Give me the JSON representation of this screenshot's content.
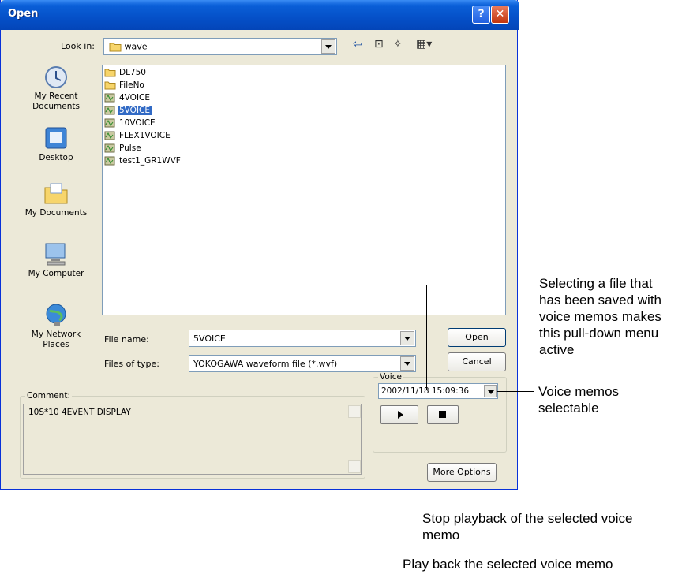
{
  "window": {
    "title": "Open"
  },
  "toolbar": {
    "look_in_label": "Look in:",
    "look_in_value": "wave"
  },
  "places": [
    {
      "label": "My Recent\nDocuments"
    },
    {
      "label": "Desktop"
    },
    {
      "label": "My Documents"
    },
    {
      "label": "My Computer"
    },
    {
      "label": "My Network\nPlaces"
    }
  ],
  "files": [
    {
      "name": "DL750",
      "type": "folder"
    },
    {
      "name": "FileNo",
      "type": "folder"
    },
    {
      "name": "4VOICE",
      "type": "wvf"
    },
    {
      "name": "5VOICE",
      "type": "wvf",
      "selected": true
    },
    {
      "name": "10VOICE",
      "type": "wvf"
    },
    {
      "name": "FLEX1VOICE",
      "type": "wvf"
    },
    {
      "name": "Pulse",
      "type": "wvf"
    },
    {
      "name": "test1_GR1WVF",
      "type": "wvf"
    }
  ],
  "form": {
    "file_name_label": "File name:",
    "file_name_value": "5VOICE",
    "file_type_label": "Files of type:",
    "file_type_value": "YOKOGAWA waveform file (*.wvf)",
    "open_label": "Open",
    "cancel_label": "Cancel"
  },
  "comment": {
    "legend": "Comment:",
    "text": "10S*10 4EVENT DISPLAY"
  },
  "voice": {
    "legend": "Voice",
    "selected": "2002/11/18 15:09:36"
  },
  "more_options_label": "More Options",
  "annotations": {
    "pulldown": "Selecting a file that\nhas been saved with\nvoice memos makes\nthis pull-down menu\nactive",
    "selectable": "Voice memos\nselectable",
    "stop": "Stop playback of the selected voice\nmemo",
    "play": "Play back the selected voice memo"
  },
  "colors": {
    "titlebar": "#0550c8",
    "selection": "#316ac5",
    "dialog_bg": "#ece9d8"
  }
}
